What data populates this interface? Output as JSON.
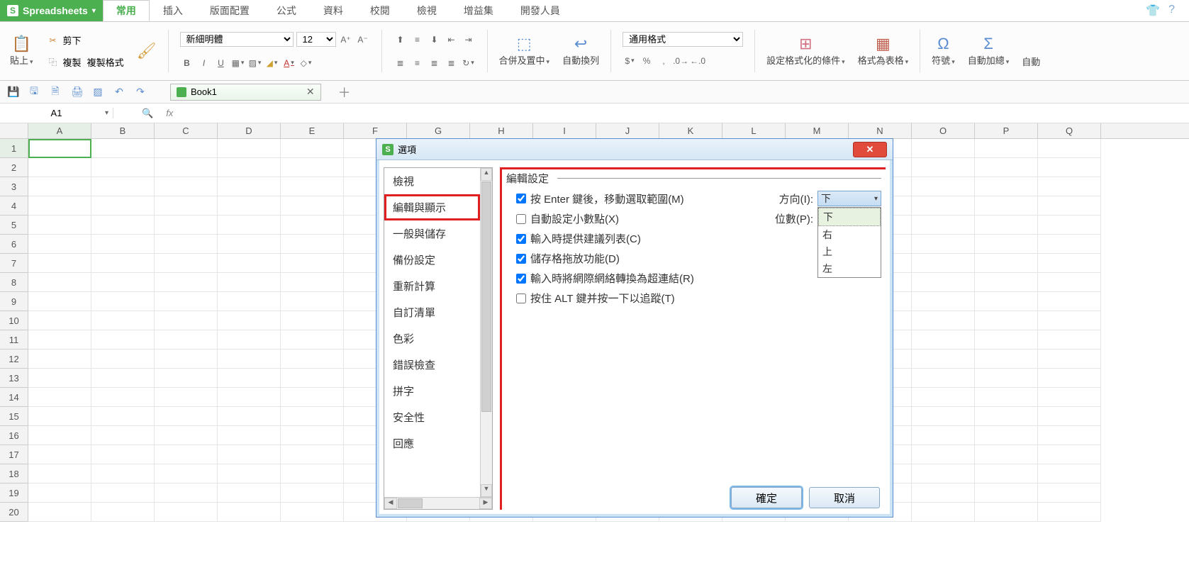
{
  "app": {
    "name": "Spreadsheets"
  },
  "menuTabs": [
    "常用",
    "插入",
    "版面配置",
    "公式",
    "資料",
    "校閱",
    "檢視",
    "增益集",
    "開發人員"
  ],
  "activeMenuTab": "常用",
  "ribbon": {
    "paste": "貼上",
    "cut": "剪下",
    "copy": "複製",
    "copyFormat": "複製格式",
    "fontName": "新細明體",
    "fontSize": "12",
    "mergeCenter": "合併及置中",
    "wrapText": "自動換列",
    "numberFormat": "通用格式",
    "condFormat": "設定格式化的條件",
    "formatTable": "格式為表格",
    "symbol": "符號",
    "autoSum": "自動加總",
    "autoX": "自動"
  },
  "document": {
    "tabName": "Book1"
  },
  "nameBox": "A1",
  "columns": [
    "A",
    "B",
    "C",
    "D",
    "E",
    "F",
    "G",
    "H",
    "I",
    "J",
    "K",
    "L",
    "M",
    "N",
    "O",
    "P",
    "Q"
  ],
  "rowCount": 20,
  "dialog": {
    "title": "選項",
    "categories": [
      "檢視",
      "編輯與顯示",
      "一般與儲存",
      "備份設定",
      "重新計算",
      "自訂清單",
      "色彩",
      "錯誤檢查",
      "拼字",
      "安全性",
      "回應"
    ],
    "selectedCategory": "編輯與顯示",
    "sectionTitle": "編輯設定",
    "options": {
      "enterMove": {
        "checked": true,
        "label": "按 Enter 鍵後，移動選取範圍(M)"
      },
      "direction": {
        "label": "方向(I):",
        "value": "下",
        "items": [
          "下",
          "右",
          "上",
          "左"
        ]
      },
      "autoDecimal": {
        "checked": false,
        "label": "自動設定小數點(X)"
      },
      "places": {
        "label": "位數(P):"
      },
      "suggest": {
        "checked": true,
        "label": "輸入時提供建議列表(C)"
      },
      "dragDrop": {
        "checked": true,
        "label": "儲存格拖放功能(D)"
      },
      "hyperlink": {
        "checked": true,
        "label": "輸入時將網際網絡轉換為超連結(R)"
      },
      "altClick": {
        "checked": false,
        "label": "按住 ALT 鍵并按一下以追蹤(T)"
      }
    },
    "ok": "確定",
    "cancel": "取消"
  }
}
